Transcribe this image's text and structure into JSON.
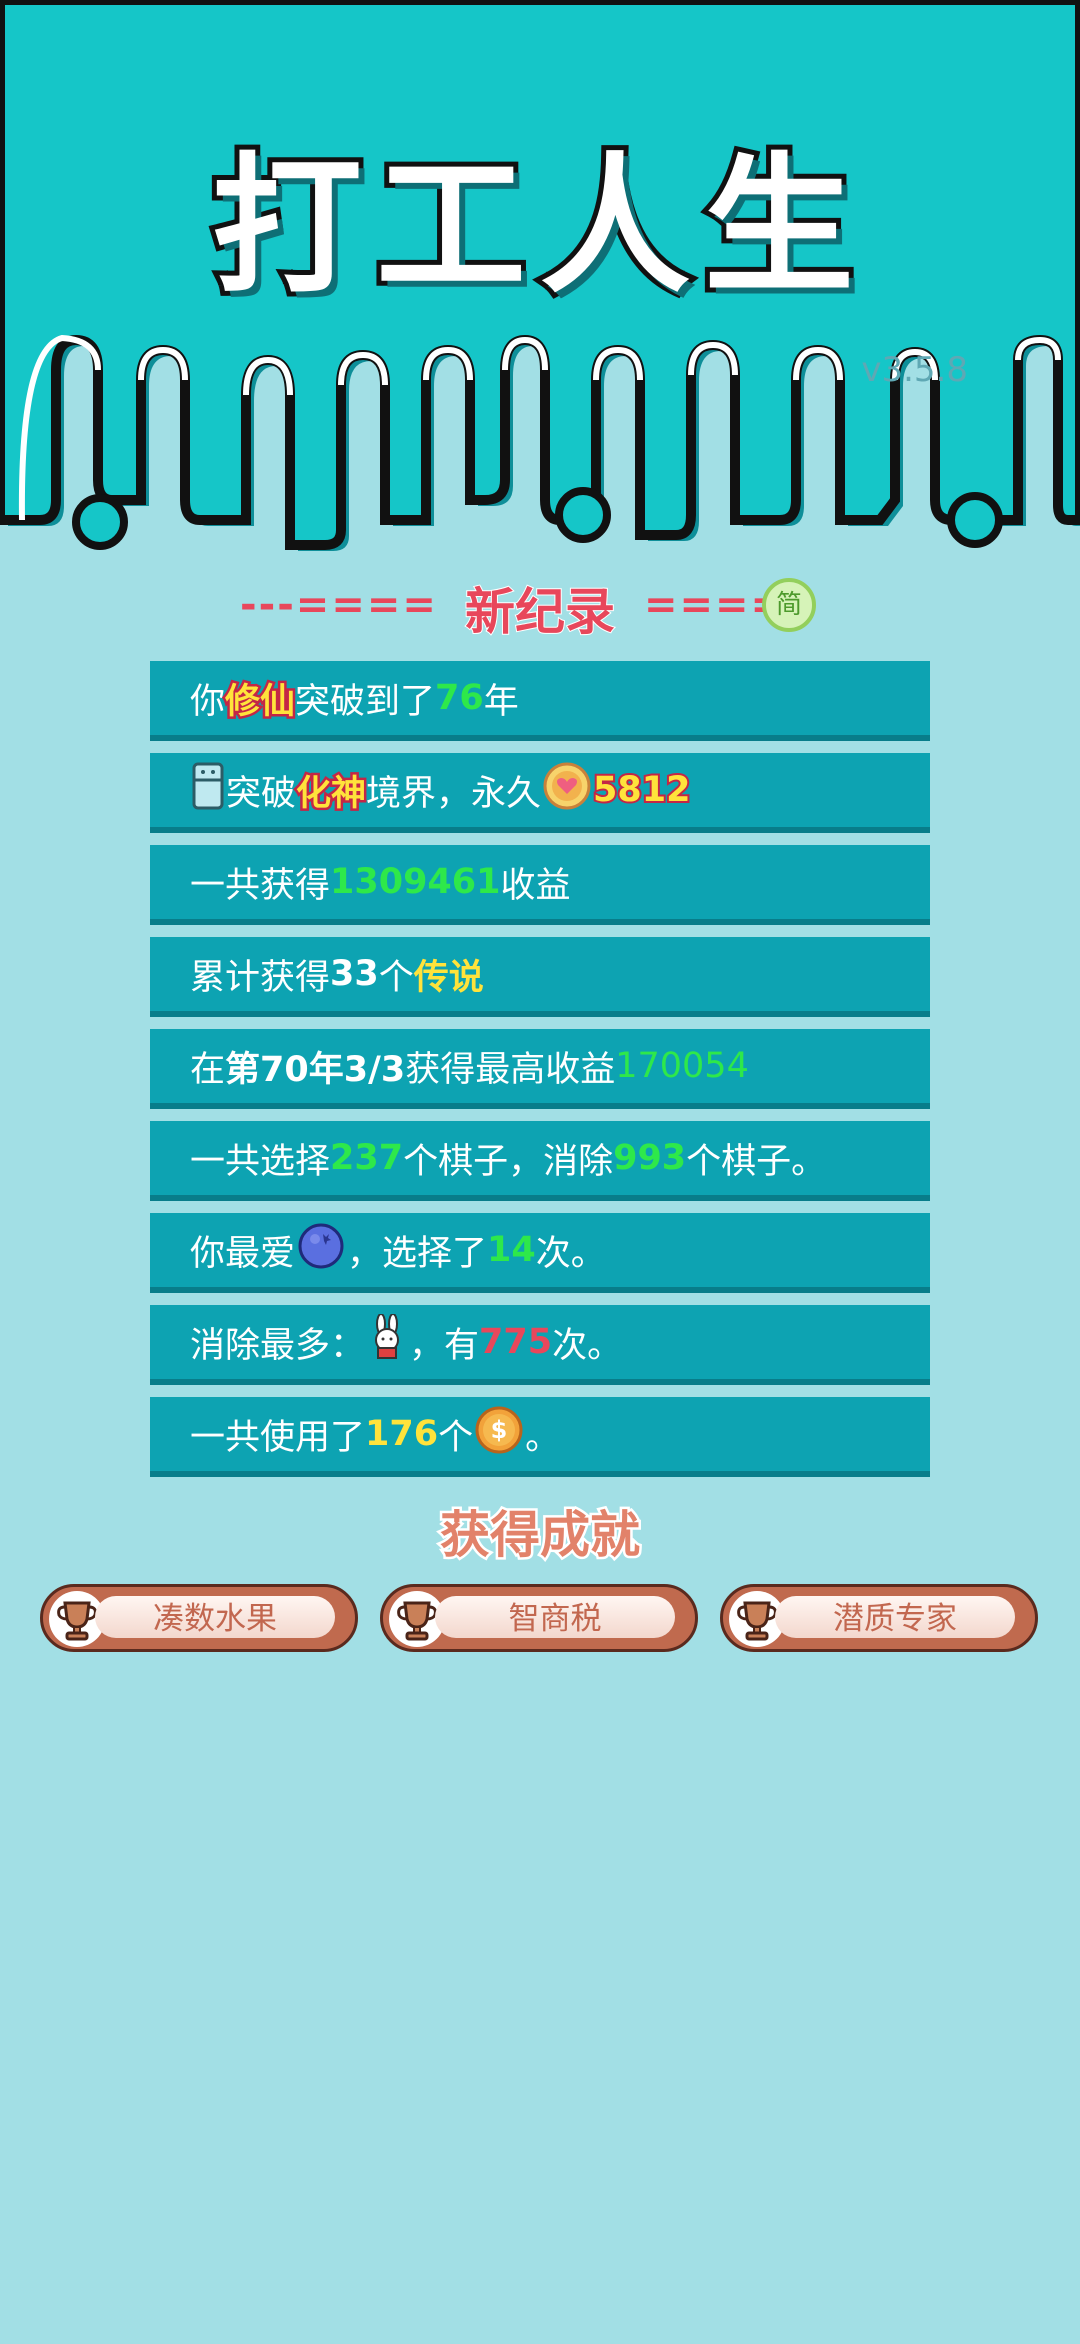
{
  "app": {
    "title": "打工人生",
    "version": "v3.5.8"
  },
  "record": {
    "title": "新纪录",
    "dashes_left": "---====",
    "dashes_right": "====-",
    "lang_button": "简"
  },
  "rows": {
    "r1": {
      "a": "你",
      "b": "修仙",
      "c": "突破到了",
      "d": "76",
      "e": "年"
    },
    "r2": {
      "a": "突破",
      "b": "化神",
      "c": "境界，永久",
      "d": "5812"
    },
    "r3": {
      "a": "一共获得",
      "b": "1309461",
      "c": "收益"
    },
    "r4": {
      "a": "累计获得",
      "b": "33",
      "c": "个",
      "d": "传说"
    },
    "r5": {
      "a": "在 ",
      "b": "第70年3/3",
      "c": " 获得最高收益",
      "d": "170054"
    },
    "r6": {
      "a": "一共选择",
      "b": "237",
      "c": "个棋子，消除",
      "d": "993",
      "e": "个棋子。"
    },
    "r7": {
      "a": "你最爱",
      "b": "，选择了",
      "c": "14",
      "d": "次。"
    },
    "r8": {
      "a": "消除最多：",
      "b": "，有",
      "c": "775",
      "d": "次。"
    },
    "r9": {
      "a": "一共使用了",
      "b": "176",
      "c": "个",
      "d": "。"
    }
  },
  "achievements": {
    "title": "获得成就",
    "items": [
      "凑数水果",
      "智商税",
      "潜质专家"
    ]
  },
  "icons": [
    "fridge-icon",
    "heart-coin-icon",
    "blueberry-icon",
    "rabbit-icon",
    "dollar-coin-icon",
    "trophy-icon"
  ],
  "colors": {
    "background": "#a2dfe5",
    "header": "#15c6c8",
    "row": "#0da3b2",
    "green": "#2ee84a",
    "yellow": "#ffe33b",
    "red": "#e8475b"
  }
}
